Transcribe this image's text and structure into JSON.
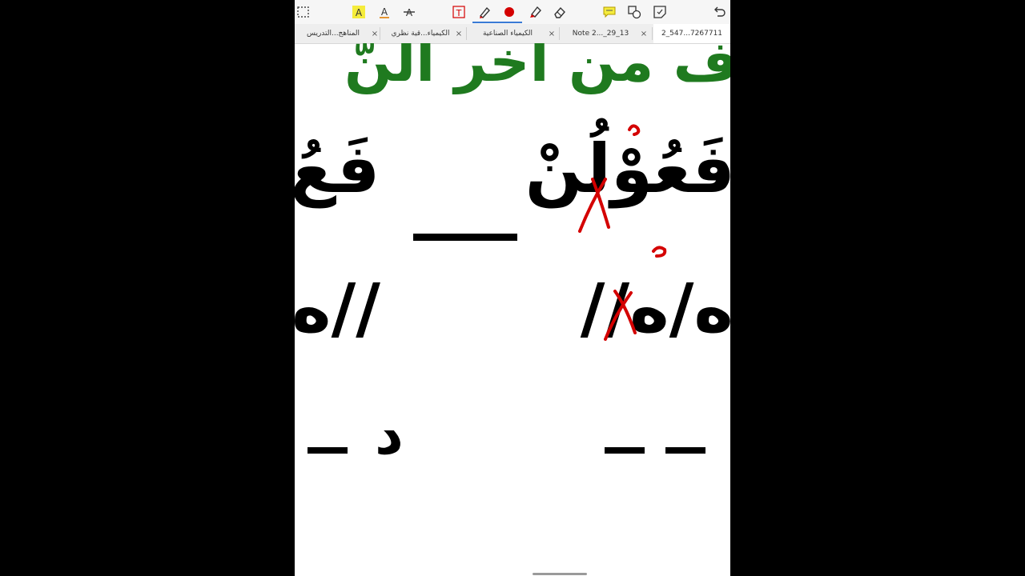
{
  "toolbar": {
    "tools": [
      {
        "name": "select-rect-icon",
        "glyph": "⬚"
      },
      {
        "name": "highlight-text-icon",
        "glyph": "A"
      },
      {
        "name": "underline-text-icon",
        "glyph": "A"
      },
      {
        "name": "strikethrough-text-icon",
        "glyph": "A"
      },
      {
        "name": "textbox-icon",
        "glyph": "T"
      },
      {
        "name": "pen-icon",
        "glyph": "✎"
      },
      {
        "name": "color-dot-icon",
        "glyph": "●"
      },
      {
        "name": "highlighter-icon",
        "glyph": "✎"
      },
      {
        "name": "eraser-icon",
        "glyph": "⌫"
      },
      {
        "name": "comment-icon",
        "glyph": "💬"
      },
      {
        "name": "shapes-icon",
        "glyph": "◇"
      },
      {
        "name": "sticky-note-icon",
        "glyph": "▢"
      },
      {
        "name": "undo-icon",
        "glyph": "↶"
      }
    ],
    "accent": "#3a7bd5",
    "pen_color": "#d40000"
  },
  "tabs": [
    {
      "label": "المناهج...التدريس"
    },
    {
      "label": "الكيمياء...قية نظري"
    },
    {
      "label": "الكيمياء الصناعية"
    },
    {
      "label": "Note 2..._29_13"
    },
    {
      "label": "2_547...7267711",
      "active": true
    }
  ],
  "content": {
    "heading_fragment": "ف من آخر النّ",
    "line1_right": "فَعُوْلُنْ",
    "line1_left": "فَعُ",
    "line2_right": "ه/ه//",
    "line2_left": "//ه",
    "line3_left": "د",
    "colors": {
      "heading": "#1f7a1f",
      "text": "#000000",
      "annotation": "#d40000"
    }
  }
}
